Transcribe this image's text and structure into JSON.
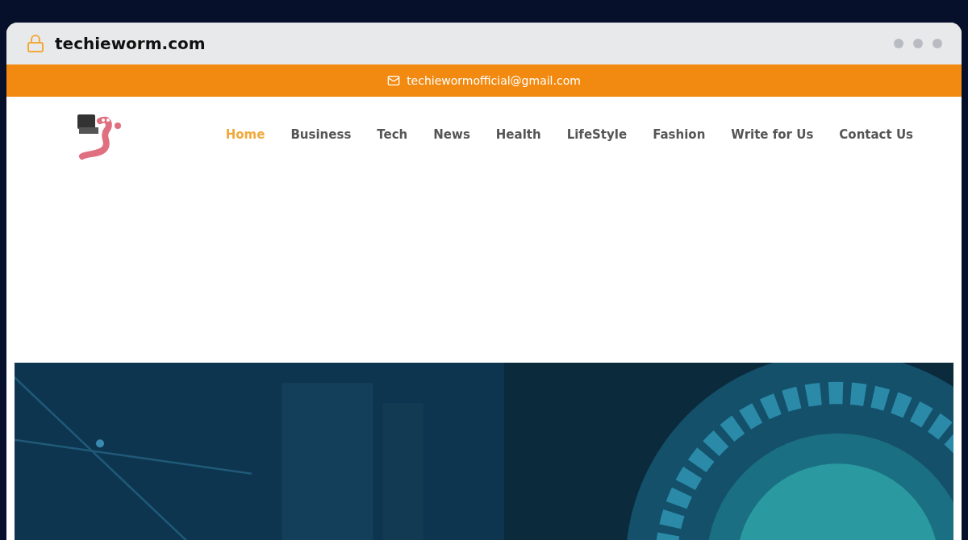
{
  "browser": {
    "url": "techieworm.com"
  },
  "top_bar": {
    "email": "techiewormofficial@gmail.com"
  },
  "nav": [
    {
      "label": "Home",
      "selected": true
    },
    {
      "label": "Business",
      "selected": false
    },
    {
      "label": "Tech",
      "selected": false
    },
    {
      "label": "News",
      "selected": false
    },
    {
      "label": "Health",
      "selected": false
    },
    {
      "label": "LifeStyle",
      "selected": false
    },
    {
      "label": "Fashion",
      "selected": false
    },
    {
      "label": "Write for Us",
      "selected": false
    },
    {
      "label": "Contact Us",
      "selected": false
    }
  ]
}
